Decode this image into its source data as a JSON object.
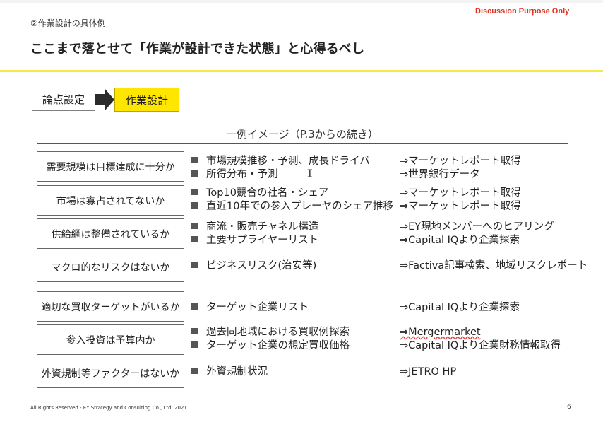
{
  "header": {
    "subtitle": "②作業設計の具体例",
    "discussion": "Discussion Purpose Only",
    "title": "ここまで落とせて「作業が設計できた状態」と心得るべし"
  },
  "flow": {
    "step1": "論点設定",
    "step2": "作業設計"
  },
  "example_label": "一例イメージ（P.3からの続き）",
  "rows": [
    {
      "question": "需要規模は目標達成に十分か",
      "items": [
        {
          "task": "市場規模推移・予測、成長ドライバ",
          "source": "⇒マーケットレポート取得"
        },
        {
          "task": "所得分布・予測",
          "source": "⇒世界銀行データ"
        }
      ]
    },
    {
      "question": "市場は寡占されてないか",
      "items": [
        {
          "task": "Top10競合の社名・シェア",
          "source": "⇒マーケットレポート取得"
        },
        {
          "task": "直近10年での参入プレーヤのシェア推移",
          "source": "⇒マーケットレポート取得"
        }
      ]
    },
    {
      "question": "供給網は整備されているか",
      "items": [
        {
          "task": "商流・販売チャネル構造",
          "source": "⇒EY現地メンバーへのヒアリング"
        },
        {
          "task": "主要サプライヤーリスト",
          "source": "⇒Capital IQより企業探索"
        }
      ]
    },
    {
      "question": "マクロ的なリスクはないか",
      "items": [
        {
          "task": "ビジネスリスク(治安等)",
          "source": "⇒Factiva記事検索、地域リスクレポート"
        }
      ]
    },
    {
      "question": "適切な買収ターゲットがいるか",
      "items": [
        {
          "task": "ターゲット企業リスト",
          "source": "⇒Capital IQより企業探索"
        }
      ]
    },
    {
      "question": "参入投資は予算内か",
      "items": [
        {
          "task": "過去同地域における買収例探索",
          "source": "⇒Mergermarket"
        },
        {
          "task": "ターゲット企業の想定買収価格",
          "source": "⇒Capital IQより企業財務情報取得"
        }
      ]
    },
    {
      "question": "外資規制等ファクターはないか",
      "items": [
        {
          "task": "外資規制状況",
          "source": "⇒JETRO HP"
        }
      ]
    }
  ],
  "footer": {
    "copyright": "All Rights Reserved - EY Strategy and Consulting Co., Ltd.  2021",
    "page": "6"
  },
  "colors": {
    "accent_yellow": "#ffe600",
    "discussion_red": "#e0301e"
  }
}
